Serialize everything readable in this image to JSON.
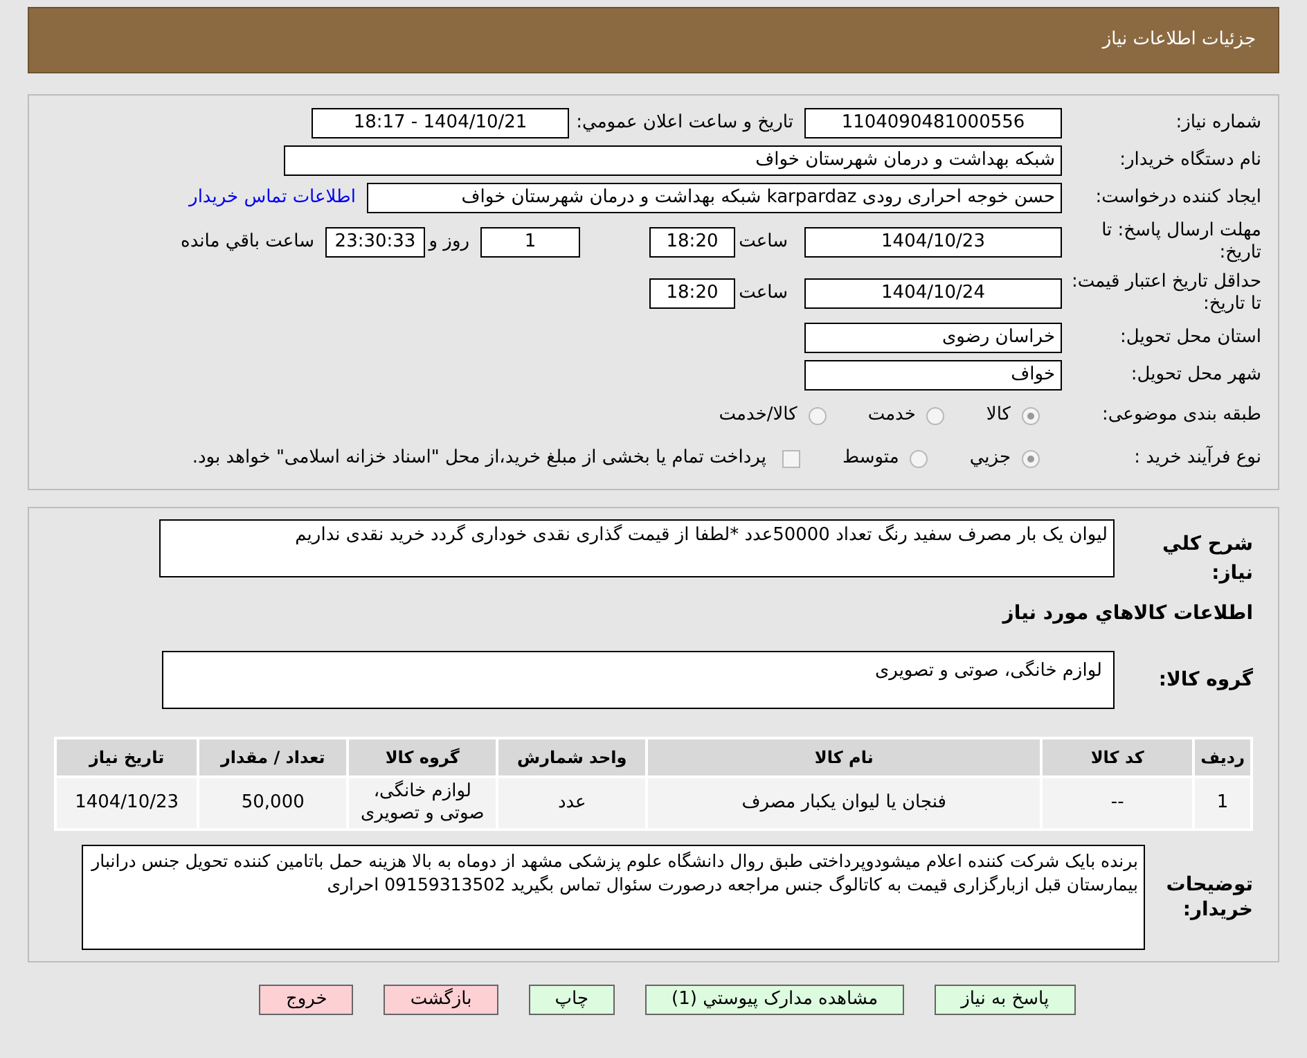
{
  "header": {
    "title": "جزئیات اطلاعات نیاز"
  },
  "need_number": {
    "label": "شماره نیاز:",
    "value": "1104090481000556"
  },
  "announce": {
    "label": "تاریخ و ساعت اعلان عمومي:",
    "value": "1404/10/21 - 18:17"
  },
  "buyer_org": {
    "label": "نام دستگاه خریدار:",
    "value": "شبکه بهداشت و درمان شهرستان خواف"
  },
  "requester": {
    "label": "ایجاد کننده درخواست:",
    "value": "حسن خوجه احراری رودی karpardaz شبکه بهداشت و درمان شهرستان خواف",
    "link": "اطلاعات تماس خریدار"
  },
  "reply_deadline": {
    "label": "مهلت ارسال پاسخ: تا تاریخ:",
    "date": "1404/10/23",
    "time_label": "ساعت",
    "time": "18:20",
    "days": "1",
    "days_label": "روز و",
    "remaining": "23:30:33",
    "remaining_label": "ساعت باقي مانده"
  },
  "price_validity": {
    "label": "حداقل تاریخ اعتبار قیمت: تا تاریخ:",
    "date": "1404/10/24",
    "time_label": "ساعت",
    "time": "18:20"
  },
  "province": {
    "label": "استان محل تحویل:",
    "value": "خراسان رضوی"
  },
  "city": {
    "label": "شهر محل تحویل:",
    "value": "خواف"
  },
  "category": {
    "label": "طبقه بندی موضوعی:",
    "options": [
      {
        "label": "كالا",
        "selected": true
      },
      {
        "label": "خدمت",
        "selected": false
      },
      {
        "label": "كالا/خدمت",
        "selected": false
      }
    ]
  },
  "purchase_type": {
    "label": "نوع فرآیند خرید :",
    "options": [
      {
        "label": "جزيي",
        "selected": true
      },
      {
        "label": "متوسط",
        "selected": false
      }
    ],
    "treasury": {
      "checked": false,
      "text": "پرداخت تمام یا بخشی از مبلغ خرید،از محل \"اسناد خزانه اسلامی\" خواهد بود."
    }
  },
  "summary": {
    "label": "شرح كلي نياز:",
    "value": "لیوان یک بار مصرف سفید رنگ تعداد 50000عدد *لطفا از قیمت گذاری نقدی خوداری گردد خرید نقدی نداریم"
  },
  "goods_heading": "اطلاعات كالاهاي مورد نياز",
  "goods_group": {
    "label": "گروه کالا:",
    "value": "لوازم خانگی، صوتی و تصویری"
  },
  "table": {
    "columns": [
      "ردیف",
      "کد کالا",
      "نام کالا",
      "واحد شمارش",
      "گروه کالا",
      "تعداد / مقدار",
      "تاریخ نیاز"
    ],
    "rows": [
      [
        "1",
        "--",
        "فنجان یا لیوان یکبار مصرف",
        "عدد",
        "لوازم خانگی، صوتی و تصویری",
        "50,000",
        "1404/10/23"
      ]
    ]
  },
  "buyer_notes": {
    "label": "توضیحات خریدار:",
    "value": "برنده بایک شرکت کننده اعلام میشودوپرداختی طبق روال دانشگاه علوم پزشکی مشهد از دوماه به بالا هزینه حمل باتامین کننده تحویل جنس درانبار بیمارستان قبل ازبارگزاری قیمت به کاتالوگ جنس مراجعه درصورت سئوال تماس بگیرید 09159313502 احراری"
  },
  "buttons": [
    {
      "label": "پاسخ به نیاز",
      "kind": "action"
    },
    {
      "label": "مشاهده مدارک پیوستي (1)",
      "kind": "action"
    },
    {
      "label": "چاپ",
      "kind": "action"
    },
    {
      "label": "بازگشت",
      "kind": "danger"
    },
    {
      "label": "خروج",
      "kind": "danger"
    }
  ]
}
